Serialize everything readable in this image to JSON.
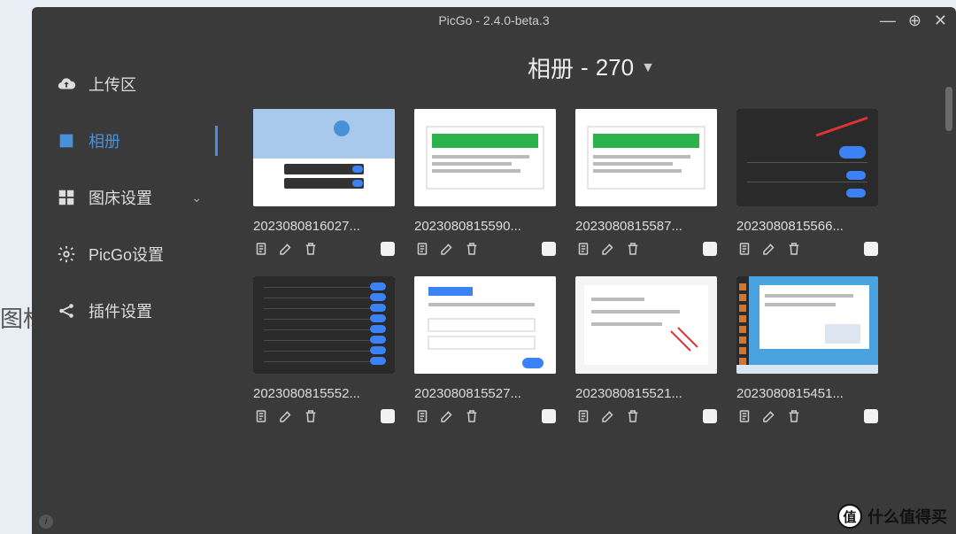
{
  "background": {
    "label": "图标"
  },
  "window": {
    "title": "PicGo - 2.4.0-beta.3",
    "controls": {
      "minimize": "—",
      "plus": "⊕",
      "close": "✕"
    }
  },
  "sidebar": {
    "items": [
      {
        "id": "upload",
        "label": "上传区",
        "icon": "cloud-upload-icon",
        "active": false
      },
      {
        "id": "album",
        "label": "相册",
        "icon": "image-icon",
        "active": true
      },
      {
        "id": "beds",
        "label": "图床设置",
        "icon": "grid-icon",
        "active": false,
        "expandable": true
      },
      {
        "id": "settings",
        "label": "PicGo设置",
        "icon": "gear-icon",
        "active": false
      },
      {
        "id": "plugins",
        "label": "插件设置",
        "icon": "share-icon",
        "active": false
      }
    ]
  },
  "page": {
    "title_prefix": "相册",
    "separator": "-",
    "count": "270"
  },
  "gallery": [
    {
      "filename": "2023080816027...",
      "thumb": "desktop-blue"
    },
    {
      "filename": "2023080815590...",
      "thumb": "green-bar"
    },
    {
      "filename": "2023080815587...",
      "thumb": "green-bar"
    },
    {
      "filename": "2023080815566...",
      "thumb": "dark-settings"
    },
    {
      "filename": "2023080815552...",
      "thumb": "dark-toggles"
    },
    {
      "filename": "2023080815527...",
      "thumb": "white-dialog"
    },
    {
      "filename": "2023080815521...",
      "thumb": "white-list"
    },
    {
      "filename": "2023080815451...",
      "thumb": "win-desktop"
    }
  ],
  "watermark": {
    "badge": "值",
    "text": "什么值得买"
  },
  "colors": {
    "accent": "#4a90d9"
  }
}
